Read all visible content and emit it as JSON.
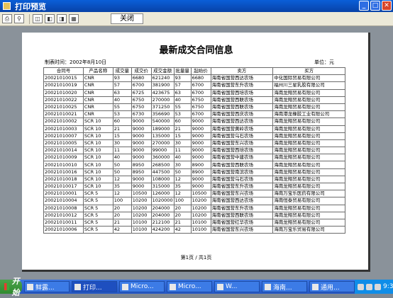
{
  "window": {
    "title": "打印预览",
    "close_tab": "关闭"
  },
  "toolbar": {
    "icons": [
      "printer-icon",
      "zoom-icon",
      "page-first-icon",
      "page-prev-icon",
      "page-next-icon",
      "page-last-icon"
    ]
  },
  "report": {
    "title": "最新成交合同信息",
    "print_time": "制表时间：2002年8月10日",
    "unit": "单位：元",
    "pager": "第1页 / 共1页",
    "headers": [
      "合同号",
      "产品名称",
      "成交量",
      "成交价",
      "成交金额",
      "批量量",
      "起始价",
      "卖方",
      "买方"
    ],
    "rows": [
      [
        "20021010015",
        "CNR",
        "93",
        "6680",
        "621240",
        "93",
        "6680",
        "海南省国营西达农场",
        "中化国际贸易有限公司"
      ],
      [
        "20021010019",
        "CNR",
        "57",
        "6700",
        "381900",
        "57",
        "6700",
        "海南省国营东升农场",
        "福州川三星乳胶有限公司"
      ],
      [
        "20021010020",
        "CNR",
        "63",
        "6725",
        "423675",
        "63",
        "6700",
        "海南省国营西培农场",
        "海南龙翔贸易有限公司"
      ],
      [
        "20021010022",
        "CNR",
        "40",
        "6750",
        "270000",
        "40",
        "6750",
        "海南省国营西联农场",
        "海南龙翔贸易有限公司"
      ],
      [
        "20021010025",
        "CNR",
        "55",
        "6750",
        "371250",
        "55",
        "6750",
        "海南省国营西联农场",
        "海南龙翔贸易有限公司"
      ],
      [
        "20021010021",
        "CNR",
        "53",
        "6730",
        "356690",
        "53",
        "6700",
        "海南省国营西庆农场",
        "海南港龙橡胶工业有限公司"
      ],
      [
        "20021010002",
        "SCR 10",
        "60",
        "9000",
        "540000",
        "60",
        "9000",
        "海南省国营西达农场",
        "海南龙翔贸易有限公司"
      ],
      [
        "20021010003",
        "SCR 10",
        "21",
        "9000",
        "189000",
        "21",
        "9000",
        "海南省国营黄岭农场",
        "海南龙翔贸易有限公司"
      ],
      [
        "20021010007",
        "SCR 10",
        "15",
        "9000",
        "135000",
        "15",
        "9000",
        "海南省国营乌石农场",
        "海南龙翔贸易有限公司"
      ],
      [
        "20021010005",
        "SCR 10",
        "30",
        "9000",
        "270000",
        "30",
        "9000",
        "海南省国营东兴农场",
        "海南龙翔贸易有限公司"
      ],
      [
        "20021010014",
        "SCR 10",
        "11",
        "9000",
        "99000",
        "11",
        "9000",
        "海南省国营西培农场",
        "海南龙翔贸易有限公司"
      ],
      [
        "20021010009",
        "SCR 10",
        "40",
        "9000",
        "360000",
        "40",
        "9000",
        "海南省国营中建农场",
        "海南龙翔贸易有限公司"
      ],
      [
        "20021010010",
        "SCR 10",
        "50",
        "8950",
        "268500",
        "30",
        "8900",
        "海南省国营西联农场",
        "海南龙翔贸易有限公司"
      ],
      [
        "20021010016",
        "SCR 10",
        "50",
        "8950",
        "447500",
        "50",
        "8900",
        "海南省国营南滨农场",
        "海南龙翔贸易有限公司"
      ],
      [
        "20021010018",
        "SCR 10",
        "12",
        "9000",
        "108000",
        "12",
        "9000",
        "海南省国营乌石农场",
        "海南龙翔贸易有限公司"
      ],
      [
        "20021010017",
        "SCR 10",
        "35",
        "9000",
        "315000",
        "35",
        "9000",
        "海南省国营东升农场",
        "海南龙翔贸易有限公司"
      ],
      [
        "20021010001",
        "SCR 5",
        "12",
        "10500",
        "126000",
        "12",
        "10500",
        "海南省国营东兴农场",
        "海南万宝乐医药有限公司"
      ],
      [
        "20021010004",
        "SCR 5",
        "100",
        "10200",
        "1020000",
        "100",
        "10200",
        "海南省国营西达农场",
        "海南恒泰贸易有限公司"
      ],
      [
        "20021010008",
        "SCR 5",
        "20",
        "10200",
        "204000",
        "20",
        "10200",
        "海南省国营东升农场",
        "海南龙翔贸易有限公司"
      ],
      [
        "20021010012",
        "SCR 5",
        "20",
        "10200",
        "204000",
        "20",
        "10200",
        "海南省国营西联农场",
        "海南龙翔贸易有限公司"
      ],
      [
        "20021010011",
        "SCR 5",
        "21",
        "10100",
        "212100",
        "21",
        "10100",
        "海南省国营红华农场",
        "海南龙翔贸易有限公司"
      ],
      [
        "20021010006",
        "SCR 5",
        "42",
        "10100",
        "424200",
        "42",
        "10100",
        "海南省国营东兴农场",
        "海南万宝乐贸易有限公司"
      ]
    ]
  },
  "taskbar": {
    "start": "开始",
    "tasks": [
      "鲜露...",
      "打印...",
      "Micro...",
      "Micro...",
      "W...",
      "海南...",
      "通用..."
    ],
    "clock": "9:37"
  }
}
